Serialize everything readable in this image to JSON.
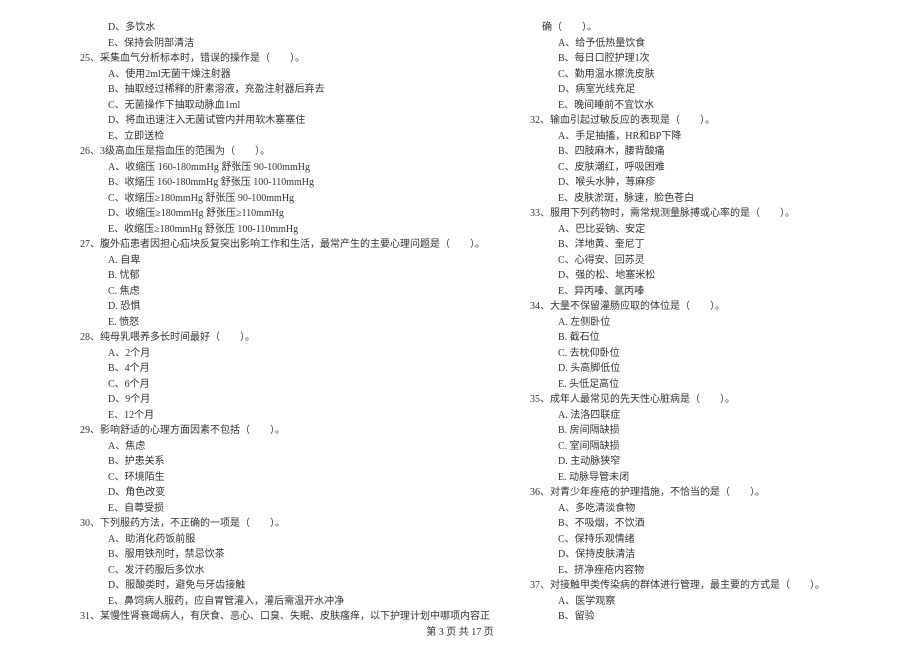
{
  "left_column": {
    "pre_options": [
      "D、多饮水",
      "E、保持会阴部清洁"
    ],
    "q25": {
      "stem": "25、采集血气分析标本时，错误的操作是（　　）。",
      "options": [
        "A、使用2ml无菌干燥注射器",
        "B、抽取经过稀释的肝素溶液，充盈注射器后弃去",
        "C、无菌操作下抽取动脉血1ml",
        "D、将血迅速注入无菌试管内并用软木塞塞住",
        "E、立即送检"
      ]
    },
    "q26": {
      "stem": "26、3级高血压是指血压的范围为（　　）。",
      "options": [
        "A、收缩压 160-180mmHg 舒张压 90-100mmHg",
        "B、收缩压 160-180mmHg 舒张压 100-110mmHg",
        "C、收缩压≥180mmHg 舒张压 90-100mmHg",
        "D、收缩压≥180mmHg 舒张压≥110mmHg",
        "E、收缩压≥180mmHg 舒张压 100-110mmHg"
      ]
    },
    "q27": {
      "stem": "27、腹外疝患者因担心疝块反复突出影响工作和生活，最常产生的主要心理问题是（　　）。",
      "options": [
        "A. 自卑",
        "B. 忧郁",
        "C. 焦虑",
        "D. 恐惧",
        "E. 愤怒"
      ]
    },
    "q28": {
      "stem": "28、纯母乳喂养多长时间最好（　　）。",
      "options": [
        "A、2个月",
        "B、4个月",
        "C、6个月",
        "D、9个月",
        "E、12个月"
      ]
    },
    "q29": {
      "stem": "29、影响舒适的心理方面因素不包括（　　）。",
      "options": [
        "A、焦虑",
        "B、护患关系",
        "C、环境陌生",
        "D、角色改变",
        "E、自尊受损"
      ]
    },
    "q30": {
      "stem": "30、下列服药方法，不正确的一项是（　　）。",
      "options": [
        "A、助消化药饭前服",
        "B、服用铁剂时，禁忌饮茶",
        "C、发汗药服后多饮水",
        "D、服酸类时，避免与牙齿接触",
        "E、鼻饲病人服药，应自胃管灌入，灌后需温开水冲净"
      ]
    },
    "q31": {
      "stem": "31、某慢性肾衰竭病人，有厌食、恶心、口臭、失眠、皮肤瘙痒，以下护理计划中哪项内容正"
    }
  },
  "right_column": {
    "q31_cont": {
      "cont": "确（　　）。",
      "options": [
        "A、给予低热量饮食",
        "B、每日口腔护理1次",
        "C、勤用温水擦洗皮肤",
        "D、病室光线充足",
        "E、晚间睡前不宜饮水"
      ]
    },
    "q32": {
      "stem": "32、输血引起过敏反应的表现是（　　）。",
      "options": [
        "A、手足抽搐，HR和BP下降",
        "B、四肢麻木，腰背酸痛",
        "C、皮肤潮红，呼吸困难",
        "D、喉头水肿，荨麻疹",
        "E、皮肤淤斑，脉速，脸色苍白"
      ]
    },
    "q33": {
      "stem": "33、服用下列药物时，需常规测量脉搏或心率的是（　　）。",
      "options": [
        "A、巴比妥钠、安定",
        "B、洋地黄、奎尼丁",
        "C、心得安、回苏灵",
        "D、强的松、地塞米松",
        "E、异丙嗪、氯丙嗪"
      ]
    },
    "q34": {
      "stem": "34、大量不保留灌肠应取的体位是（　　）。",
      "options": [
        "A. 左侧卧位",
        "B. 截石位",
        "C. 去枕仰卧位",
        "D. 头高脚低位",
        "E. 头低足高位"
      ]
    },
    "q35": {
      "stem": "35、成年人最常见的先天性心脏病是（　　）。",
      "options": [
        "A. 法洛四联症",
        "B. 房间隔缺损",
        "C. 室间隔缺损",
        "D. 主动脉狭窄",
        "E. 动脉导管未闭"
      ]
    },
    "q36": {
      "stem": "36、对青少年痤疮的护理措施，不恰当的是（　　）。",
      "options": [
        "A、多吃清淡食物",
        "B、不吸烟，不饮酒",
        "C、保持乐观情绪",
        "D、保持皮肤清洁",
        "E、挤净痤疮内容物"
      ]
    },
    "q37": {
      "stem": "37、对接触甲类传染病的群体进行管理，最主要的方式是（　　）。",
      "options": [
        "A、医学观察",
        "B、留验"
      ]
    }
  },
  "footer": "第 3 页 共 17 页"
}
